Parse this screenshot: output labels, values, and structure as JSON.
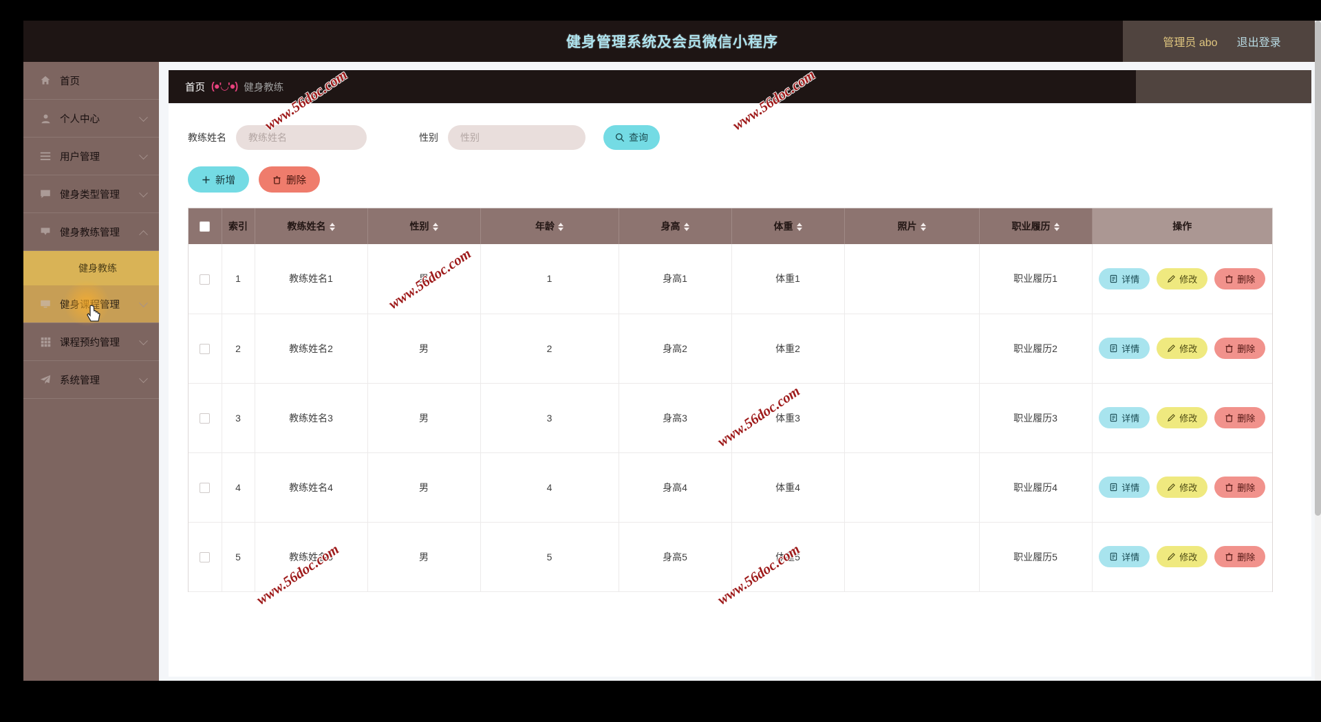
{
  "header": {
    "title": "健身管理系统及会员微信小程序",
    "admin_label": "管理员 abo",
    "logout_label": "退出登录",
    "title_color": "#aee4ef",
    "admin_color": "#e0c67f",
    "bg_color": "#1e1514"
  },
  "breadcrumb": {
    "home": "首页",
    "separator": "(●'◡'●)",
    "current": "健身教练"
  },
  "sidebar": {
    "bg_color": "#7d6560",
    "active_color": "#d9b356",
    "items": [
      {
        "label": "首页",
        "icon": "home-icon",
        "expandable": false,
        "state": "normal"
      },
      {
        "label": "个人中心",
        "icon": "user-icon",
        "expandable": true,
        "state": "normal"
      },
      {
        "label": "用户管理",
        "icon": "list-icon",
        "expandable": true,
        "state": "normal"
      },
      {
        "label": "健身类型管理",
        "icon": "comment-icon",
        "expandable": true,
        "state": "normal"
      },
      {
        "label": "健身教练管理",
        "icon": "tag-icon",
        "expandable": true,
        "expanded": true,
        "state": "normal"
      },
      {
        "label": "健身课程管理",
        "icon": "monitor-icon",
        "expandable": true,
        "state": "hovered"
      },
      {
        "label": "课程预约管理",
        "icon": "grid-icon",
        "expandable": true,
        "state": "normal"
      },
      {
        "label": "系统管理",
        "icon": "send-icon",
        "expandable": true,
        "state": "normal"
      }
    ],
    "submenu": [
      {
        "label": "健身教练",
        "active": true
      }
    ]
  },
  "search": {
    "name_label": "教练姓名",
    "name_placeholder": "教练姓名",
    "name_value": "",
    "gender_label": "性别",
    "gender_placeholder": "性别",
    "gender_value": "",
    "search_button": "查询",
    "search_icon": "search-icon"
  },
  "actions": {
    "add_label": "新增",
    "add_icon": "plus-icon",
    "delete_label": "删除",
    "delete_icon": "trash-icon"
  },
  "table": {
    "columns": [
      {
        "key": "checkbox",
        "label": "",
        "sortable": false
      },
      {
        "key": "index",
        "label": "索引",
        "sortable": false
      },
      {
        "key": "name",
        "label": "教练姓名",
        "sortable": true
      },
      {
        "key": "gender",
        "label": "性别",
        "sortable": true
      },
      {
        "key": "age",
        "label": "年龄",
        "sortable": true
      },
      {
        "key": "height",
        "label": "身高",
        "sortable": true
      },
      {
        "key": "weight",
        "label": "体重",
        "sortable": true
      },
      {
        "key": "photo",
        "label": "照片",
        "sortable": true
      },
      {
        "key": "resume",
        "label": "职业履历",
        "sortable": true
      },
      {
        "key": "ops",
        "label": "操作",
        "sortable": false
      }
    ],
    "rows": [
      {
        "index": "1",
        "name": "教练姓名1",
        "gender": "男",
        "age": "1",
        "height": "身高1",
        "weight": "体重1",
        "photo": "",
        "resume": "职业履历1"
      },
      {
        "index": "2",
        "name": "教练姓名2",
        "gender": "男",
        "age": "2",
        "height": "身高2",
        "weight": "体重2",
        "photo": "",
        "resume": "职业履历2"
      },
      {
        "index": "3",
        "name": "教练姓名3",
        "gender": "男",
        "age": "3",
        "height": "身高3",
        "weight": "体重3",
        "photo": "",
        "resume": "职业履历3"
      },
      {
        "index": "4",
        "name": "教练姓名4",
        "gender": "男",
        "age": "4",
        "height": "身高4",
        "weight": "体重4",
        "photo": "",
        "resume": "职业履历4"
      },
      {
        "index": "5",
        "name": "教练姓名5",
        "gender": "男",
        "age": "5",
        "height": "身高5",
        "weight": "体重5",
        "photo": "",
        "resume": "职业履历5"
      }
    ],
    "row_buttons": {
      "detail": "详情",
      "detail_icon": "document-icon",
      "edit": "修改",
      "edit_icon": "pencil-icon",
      "delete": "删除",
      "delete_icon": "trash-icon"
    }
  },
  "watermark": {
    "text": "www.56doc.com",
    "color": "#9e1b1b"
  }
}
